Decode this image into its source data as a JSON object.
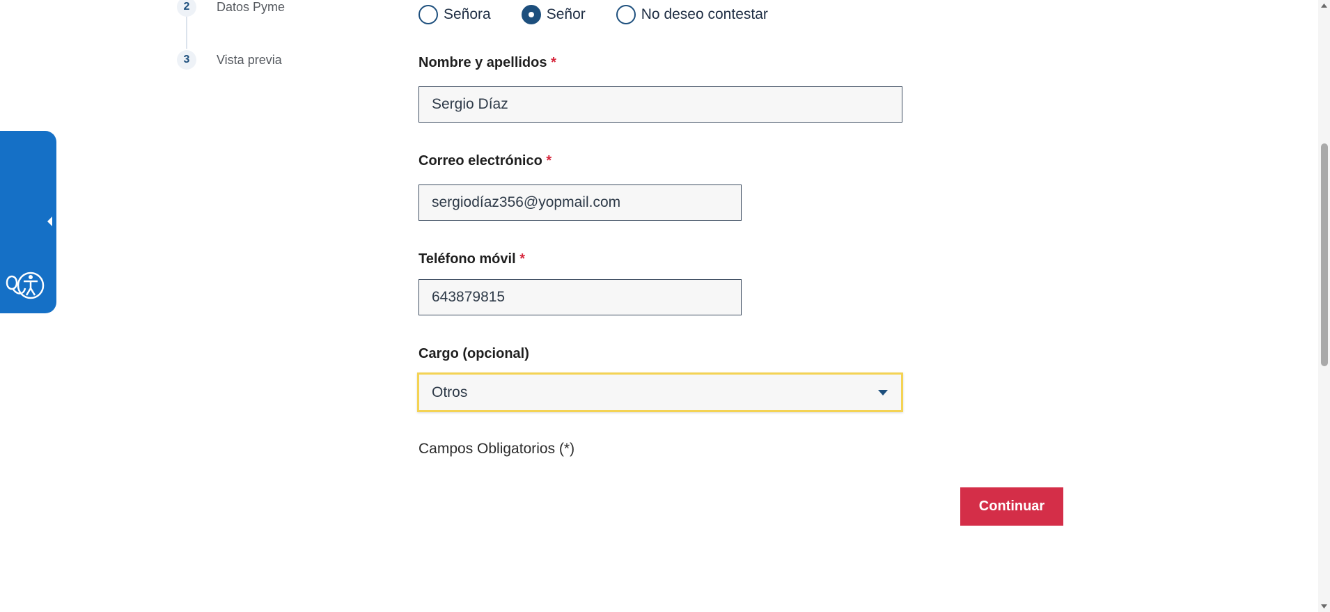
{
  "stepper": {
    "steps": [
      {
        "number": "2",
        "label": "Datos Pyme"
      },
      {
        "number": "3",
        "label": "Vista previa"
      }
    ]
  },
  "accessibility": {
    "line1": "HERRAMIENTAS DE",
    "line2": "ACCESIBILIDAD"
  },
  "form": {
    "salutation": {
      "options": [
        "Señora",
        "Señor",
        "No deseo contestar"
      ],
      "selected": "Señor"
    },
    "name": {
      "label": "Nombre y apellidos",
      "required_mark": "*",
      "value": "Sergio Díaz"
    },
    "email": {
      "label": "Correo electrónico",
      "required_mark": "*",
      "value": "sergiodíaz356@yopmail.com"
    },
    "phone": {
      "label": "Teléfono móvil",
      "required_mark": "*",
      "value": "643879815"
    },
    "position": {
      "label": "Cargo (opcional)",
      "selected": "Otros"
    },
    "required_note": "Campos Obligatorios (*)",
    "continue_label": "Continuar"
  },
  "colors": {
    "accent": "#1d4f7d",
    "button": "#d42e48",
    "focus": "#f4d354",
    "a11y_tab": "#1570c6"
  }
}
